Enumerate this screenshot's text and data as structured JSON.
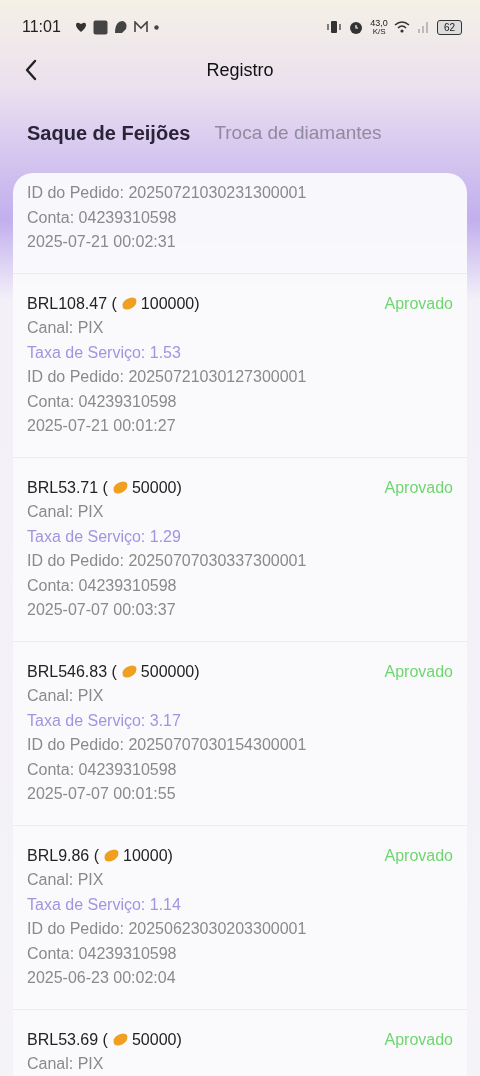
{
  "status_bar": {
    "time": "11:01",
    "speed": "43,0",
    "speed_unit": "K/S",
    "battery": "62"
  },
  "header": {
    "title": "Registro"
  },
  "tabs": [
    {
      "label": "Saque de Feijões",
      "selected": true
    },
    {
      "label": "Troca de diamantes",
      "selected": false
    }
  ],
  "records": [
    {
      "order_id": "ID do Pedido: 20250721030231300001",
      "account": "Conta: 04239310598",
      "date": "2025-07-21 00:02:31"
    },
    {
      "amount": "BRL108.47 (",
      "beans": "100000)",
      "status": "Aprovado",
      "channel": "Canal: PIX",
      "fee": "Taxa de Serviço: 1.53",
      "order_id": "ID do Pedido: 20250721030127300001",
      "account": "Conta: 04239310598",
      "date": "2025-07-21 00:01:27"
    },
    {
      "amount": "BRL53.71 (",
      "beans": "50000)",
      "status": "Aprovado",
      "channel": "Canal: PIX",
      "fee": "Taxa de Serviço: 1.29",
      "order_id": "ID do Pedido: 20250707030337300001",
      "account": "Conta: 04239310598",
      "date": "2025-07-07 00:03:37"
    },
    {
      "amount": "BRL546.83 (",
      "beans": "500000)",
      "status": "Aprovado",
      "channel": "Canal: PIX",
      "fee": "Taxa de Serviço: 3.17",
      "order_id": "ID do Pedido: 20250707030154300001",
      "account": "Conta: 04239310598",
      "date": "2025-07-07 00:01:55"
    },
    {
      "amount": "BRL9.86 (",
      "beans": "10000)",
      "status": "Aprovado",
      "channel": "Canal: PIX",
      "fee": "Taxa de Serviço: 1.14",
      "order_id": "ID do Pedido: 20250623030203300001",
      "account": "Conta: 04239310598",
      "date": "2025-06-23 00:02:04"
    },
    {
      "amount": "BRL53.69 (",
      "beans": "50000)",
      "status": "Aprovado",
      "channel": "Canal: PIX"
    }
  ]
}
